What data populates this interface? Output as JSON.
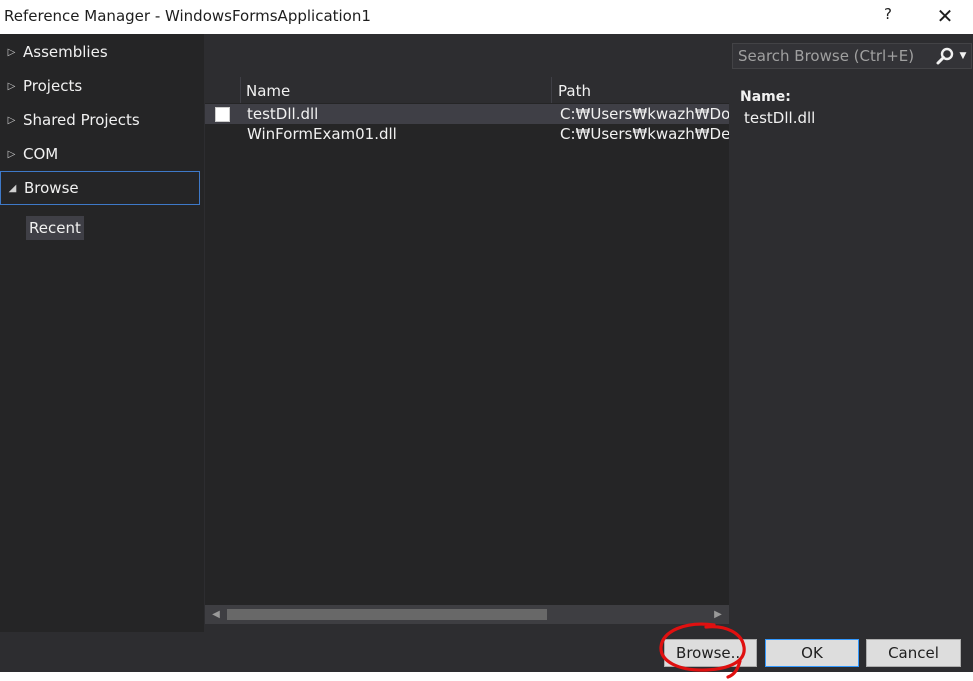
{
  "window": {
    "title": "Reference Manager - WindowsFormsApplication1",
    "help_label": "?",
    "close_label": "✕"
  },
  "nav": {
    "items": [
      {
        "label": "Assemblies",
        "expanded": false
      },
      {
        "label": "Projects",
        "expanded": false
      },
      {
        "label": "Shared Projects",
        "expanded": false
      },
      {
        "label": "COM",
        "expanded": false
      },
      {
        "label": "Browse",
        "expanded": true,
        "selected": true
      }
    ],
    "sub_items": [
      {
        "label": "Recent",
        "selected": true
      }
    ]
  },
  "list": {
    "columns": [
      "Name",
      "Path"
    ],
    "rows": [
      {
        "name": "testDll.dll",
        "path": "C:₩Users₩kwazh₩Docum",
        "checked": false,
        "selected": true
      },
      {
        "name": "WinFormExam01.dll",
        "path": "C:₩Users₩kwazh₩Deskto",
        "checked": null,
        "selected": false
      }
    ]
  },
  "search": {
    "placeholder": "Search Browse (Ctrl+E)",
    "value": ""
  },
  "details": {
    "name_label": "Name:",
    "name_value": "testDll.dll"
  },
  "buttons": {
    "browse": "Browse...",
    "ok": "OK",
    "cancel": "Cancel"
  },
  "colors": {
    "dialog_bg": "#2d2d30",
    "panel_bg": "#252526",
    "selection_border": "#3e79c8",
    "annotation": "#e01010"
  },
  "icons": {
    "collapsed": "triangle-right-outline",
    "expanded": "triangle-down-filled",
    "search": "magnifier-icon",
    "dropdown": "chevron-down-icon"
  }
}
